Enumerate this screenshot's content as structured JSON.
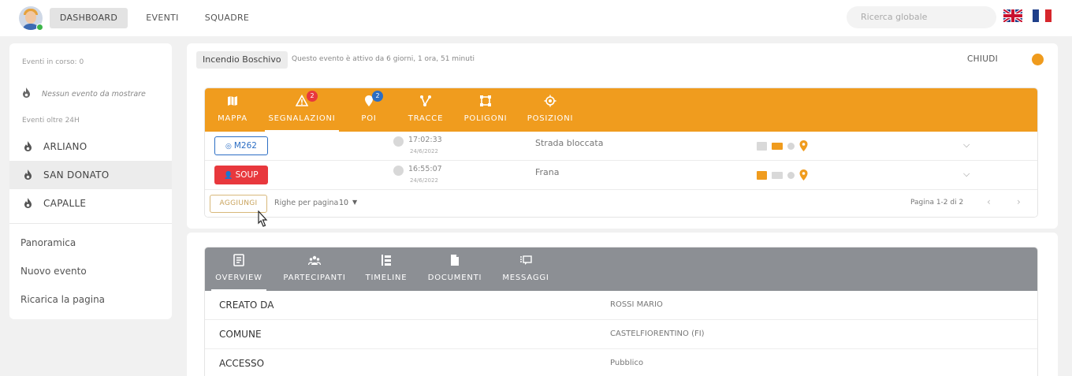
{
  "nav": {
    "dashboard": "DASHBOARD",
    "eventi": "EVENTI",
    "squadre": "SQUADRE",
    "search_placeholder": "Ricerca globale"
  },
  "colors": {
    "accent": "#f09c1e",
    "danger": "#e8383d",
    "primary": "#2c6ec4",
    "details_bar": "#8c8f94",
    "online": "#3cb54a"
  },
  "sidebar": {
    "ongoing_label": "Eventi in corso: 0",
    "empty_message": "Nessun evento da mostrare",
    "older_label": "Eventi oltre 24H",
    "events": [
      {
        "name": "ARLIANO",
        "selected": false
      },
      {
        "name": "SAN DONATO",
        "selected": true
      },
      {
        "name": "CAPALLE",
        "selected": false
      }
    ],
    "links": [
      "Panoramica",
      "Nuovo evento",
      "Ricarica la pagina"
    ]
  },
  "event": {
    "type": "Incendio Boschivo",
    "status": "Questo evento è attivo da 6 giorni, 1 ora, 51 minuti",
    "close_label": "CHIUDI",
    "tabs": [
      {
        "label": "MAPPA",
        "icon": "map-icon",
        "badge": ""
      },
      {
        "label": "SEGNALAZIONI",
        "icon": "warning-icon",
        "badge": "2",
        "active": true
      },
      {
        "label": "POI",
        "icon": "poi-pin-icon",
        "badge": "2"
      },
      {
        "label": "TRACCE",
        "icon": "route-icon",
        "badge": ""
      },
      {
        "label": "POLIGONI",
        "icon": "polygon-icon",
        "badge": ""
      },
      {
        "label": "POSIZIONI",
        "icon": "location-target-icon",
        "badge": ""
      }
    ],
    "rows": [
      {
        "code": "M262",
        "time": "17:02:33",
        "date": "24/6/2022",
        "description": "Strada bloccata",
        "image": false,
        "video": true,
        "audio": false,
        "position": true
      },
      {
        "code": "SOUP",
        "time": "16:55:07",
        "date": "24/6/2022",
        "description": "Frana",
        "image": true,
        "video": false,
        "audio": false,
        "position": true
      }
    ],
    "add_label": "AGGIUNGI",
    "rows_per_page_label": "Righe per pagina",
    "rows_per_page_value": "10",
    "page_label": "Pagina 1-2 di 2"
  },
  "details": {
    "tabs": [
      {
        "label": "OVERVIEW",
        "icon": "overview-icon",
        "active": true
      },
      {
        "label": "PARTECIPANTI",
        "icon": "participants-icon"
      },
      {
        "label": "TIMELINE",
        "icon": "timeline-icon"
      },
      {
        "label": "DOCUMENTI",
        "icon": "document-icon"
      },
      {
        "label": "MESSAGGI",
        "icon": "messages-icon"
      }
    ],
    "fields": [
      {
        "label": "CREATO DA",
        "value": "ROSSI MARIO"
      },
      {
        "label": "COMUNE",
        "value": "CASTELFIORENTINO (FI)"
      },
      {
        "label": "ACCESSO",
        "value": "Pubblico"
      }
    ]
  }
}
